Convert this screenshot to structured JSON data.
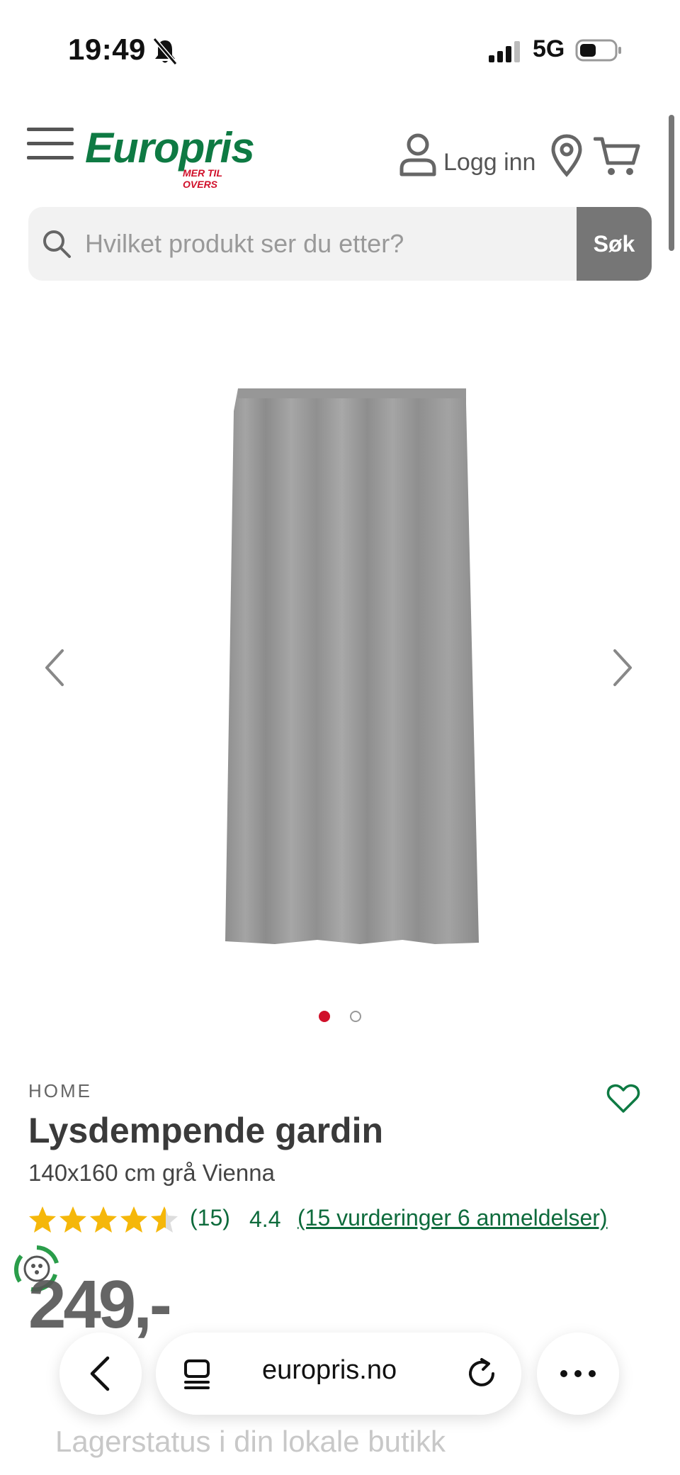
{
  "status_bar": {
    "time": "19:49",
    "network": "5G"
  },
  "header": {
    "logo_text": "Europris",
    "logo_tagline": "MER TIL OVERS",
    "login_label": "Logg inn"
  },
  "search": {
    "placeholder": "Hvilket produkt ser du etter?",
    "button_label": "Søk"
  },
  "carousel": {
    "slide_count": 2,
    "active_index": 0
  },
  "product": {
    "brand": "HOME",
    "title": "Lysdempende gardin",
    "subtitle": "140x160 cm grå Vienna",
    "rating_count": "(15)",
    "rating_value": "4.4",
    "rating_fraction": 0.88,
    "reviews_link": "(15 vurderinger 6 anmeldelser)",
    "price": "249,-",
    "stock_label": "Lagerstatus i din lokale butikk"
  },
  "browser": {
    "url": "europris.no"
  },
  "colors": {
    "brand_green": "#0e7a43",
    "brand_red": "#d0102a",
    "star": "#f5b70a",
    "search_button": "#767676"
  },
  "icons": [
    "bell-slash-icon",
    "signal-icon",
    "battery-icon",
    "hamburger-icon",
    "user-icon",
    "location-pin-icon",
    "cart-icon",
    "search-icon",
    "chevron-left-icon",
    "chevron-right-icon",
    "heart-icon",
    "star-icon",
    "eco-badge-icon",
    "tabs-icon",
    "reload-icon",
    "more-icon"
  ]
}
